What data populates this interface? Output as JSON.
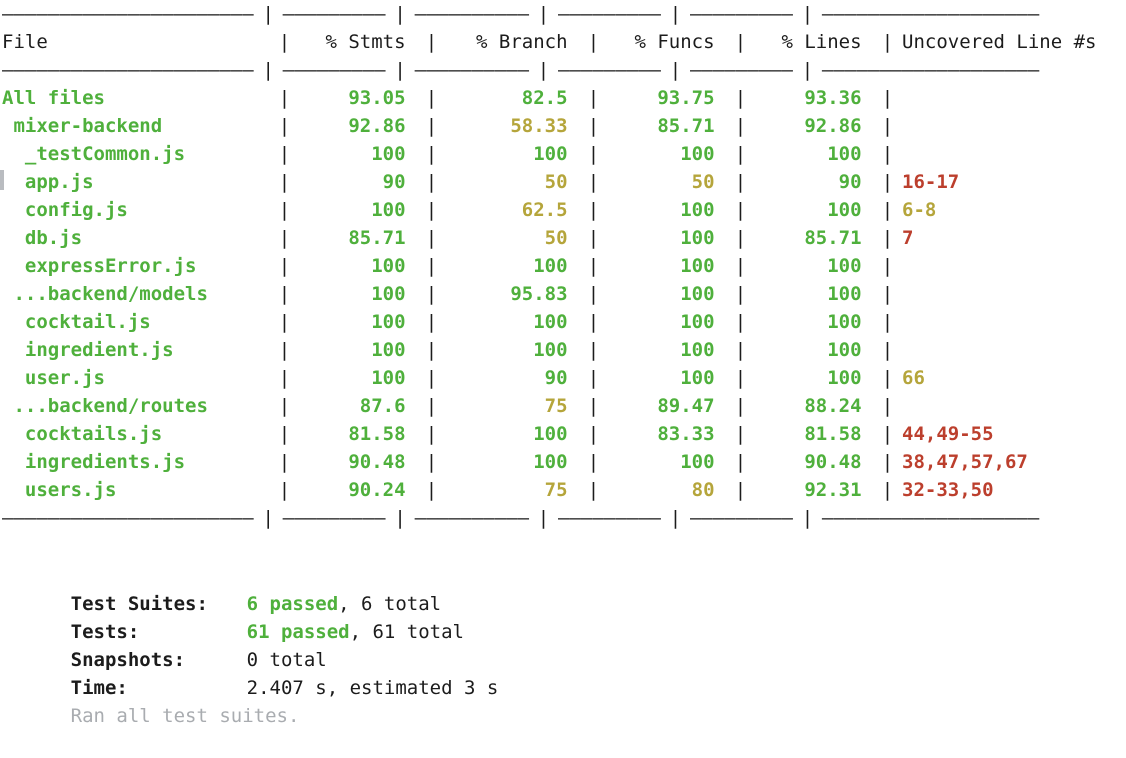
{
  "terminal": {
    "kind": "jest-coverage-report",
    "background_color": "#ffffff",
    "text_color": "#1c1c1c",
    "colors": {
      "high": "#4fb03c",
      "medium": "#b5a53b",
      "uncovered": "#bc3f2d",
      "dim": "#a9acb0"
    }
  },
  "table": {
    "separator": "----------------------|---------|----------|---------|---------|-------------------",
    "separator_top": "———————————————————",
    "columns": [
      {
        "key": "file",
        "label": "File"
      },
      {
        "key": "stmts",
        "label": "% Stmts"
      },
      {
        "key": "branch",
        "label": "% Branch"
      },
      {
        "key": "funcs",
        "label": "% Funcs"
      },
      {
        "key": "lines",
        "label": "% Lines"
      },
      {
        "key": "uncovered",
        "label": "Uncovered Line #s"
      }
    ],
    "rows": [
      {
        "file": "All files",
        "file_indent": 0,
        "file_color": "g",
        "stmts": "93.05",
        "stmts_color": "g",
        "branch": "82.5",
        "branch_color": "g",
        "funcs": "93.75",
        "funcs_color": "g",
        "lines": "93.36",
        "lines_color": "g",
        "uncovered": "",
        "uncovered_color": "r"
      },
      {
        "file": "mixer-backend",
        "file_indent": 1,
        "file_color": "g",
        "stmts": "92.86",
        "stmts_color": "g",
        "branch": "58.33",
        "branch_color": "y",
        "funcs": "85.71",
        "funcs_color": "g",
        "lines": "92.86",
        "lines_color": "g",
        "uncovered": "",
        "uncovered_color": "r"
      },
      {
        "file": "_testCommon.js",
        "file_indent": 2,
        "file_color": "g",
        "stmts": "100",
        "stmts_color": "g",
        "branch": "100",
        "branch_color": "g",
        "funcs": "100",
        "funcs_color": "g",
        "lines": "100",
        "lines_color": "g",
        "uncovered": "",
        "uncovered_color": "r"
      },
      {
        "file": "app.js",
        "file_indent": 2,
        "file_color": "g",
        "stmts": "90",
        "stmts_color": "g",
        "branch": "50",
        "branch_color": "y",
        "funcs": "50",
        "funcs_color": "y",
        "lines": "90",
        "lines_color": "g",
        "uncovered": "16-17",
        "uncovered_color": "r"
      },
      {
        "file": "config.js",
        "file_indent": 2,
        "file_color": "g",
        "stmts": "100",
        "stmts_color": "g",
        "branch": "62.5",
        "branch_color": "y",
        "funcs": "100",
        "funcs_color": "g",
        "lines": "100",
        "lines_color": "g",
        "uncovered": "6-8",
        "uncovered_color": "y"
      },
      {
        "file": "db.js",
        "file_indent": 2,
        "file_color": "g",
        "stmts": "85.71",
        "stmts_color": "g",
        "branch": "50",
        "branch_color": "y",
        "funcs": "100",
        "funcs_color": "g",
        "lines": "85.71",
        "lines_color": "g",
        "uncovered": "7",
        "uncovered_color": "r"
      },
      {
        "file": "expressError.js",
        "file_indent": 2,
        "file_color": "g",
        "stmts": "100",
        "stmts_color": "g",
        "branch": "100",
        "branch_color": "g",
        "funcs": "100",
        "funcs_color": "g",
        "lines": "100",
        "lines_color": "g",
        "uncovered": "",
        "uncovered_color": "r"
      },
      {
        "file": "...backend/models",
        "file_indent": 1,
        "file_color": "g",
        "stmts": "100",
        "stmts_color": "g",
        "branch": "95.83",
        "branch_color": "g",
        "funcs": "100",
        "funcs_color": "g",
        "lines": "100",
        "lines_color": "g",
        "uncovered": "",
        "uncovered_color": "r"
      },
      {
        "file": "cocktail.js",
        "file_indent": 2,
        "file_color": "g",
        "stmts": "100",
        "stmts_color": "g",
        "branch": "100",
        "branch_color": "g",
        "funcs": "100",
        "funcs_color": "g",
        "lines": "100",
        "lines_color": "g",
        "uncovered": "",
        "uncovered_color": "r"
      },
      {
        "file": "ingredient.js",
        "file_indent": 2,
        "file_color": "g",
        "stmts": "100",
        "stmts_color": "g",
        "branch": "100",
        "branch_color": "g",
        "funcs": "100",
        "funcs_color": "g",
        "lines": "100",
        "lines_color": "g",
        "uncovered": "",
        "uncovered_color": "r"
      },
      {
        "file": "user.js",
        "file_indent": 2,
        "file_color": "g",
        "stmts": "100",
        "stmts_color": "g",
        "branch": "90",
        "branch_color": "g",
        "funcs": "100",
        "funcs_color": "g",
        "lines": "100",
        "lines_color": "g",
        "uncovered": "66",
        "uncovered_color": "y"
      },
      {
        "file": "...backend/routes",
        "file_indent": 1,
        "file_color": "g",
        "stmts": "87.6",
        "stmts_color": "g",
        "branch": "75",
        "branch_color": "y",
        "funcs": "89.47",
        "funcs_color": "g",
        "lines": "88.24",
        "lines_color": "g",
        "uncovered": "",
        "uncovered_color": "r"
      },
      {
        "file": "cocktails.js",
        "file_indent": 2,
        "file_color": "g",
        "stmts": "81.58",
        "stmts_color": "g",
        "branch": "100",
        "branch_color": "g",
        "funcs": "83.33",
        "funcs_color": "g",
        "lines": "81.58",
        "lines_color": "g",
        "uncovered": "44,49-55",
        "uncovered_color": "r"
      },
      {
        "file": "ingredients.js",
        "file_indent": 2,
        "file_color": "g",
        "stmts": "90.48",
        "stmts_color": "g",
        "branch": "100",
        "branch_color": "g",
        "funcs": "100",
        "funcs_color": "g",
        "lines": "90.48",
        "lines_color": "g",
        "uncovered": "38,47,57,67",
        "uncovered_color": "r"
      },
      {
        "file": "users.js",
        "file_indent": 2,
        "file_color": "g",
        "stmts": "90.24",
        "stmts_color": "g",
        "branch": "75",
        "branch_color": "y",
        "funcs": "80",
        "funcs_color": "y",
        "lines": "92.31",
        "lines_color": "g",
        "uncovered": "32-33,50",
        "uncovered_color": "r"
      }
    ]
  },
  "summary": {
    "test_suites": {
      "label": "Test Suites:",
      "passed": "6 passed",
      "rest": ", 6 total"
    },
    "tests": {
      "label": "Tests:",
      "passed": "61 passed",
      "rest": ", 61 total"
    },
    "snapshots": {
      "label": "Snapshots:",
      "value": "0 total"
    },
    "time": {
      "label": "Time:",
      "value": "2.407 s, estimated 3 s"
    },
    "footer": "Ran all test suites."
  }
}
